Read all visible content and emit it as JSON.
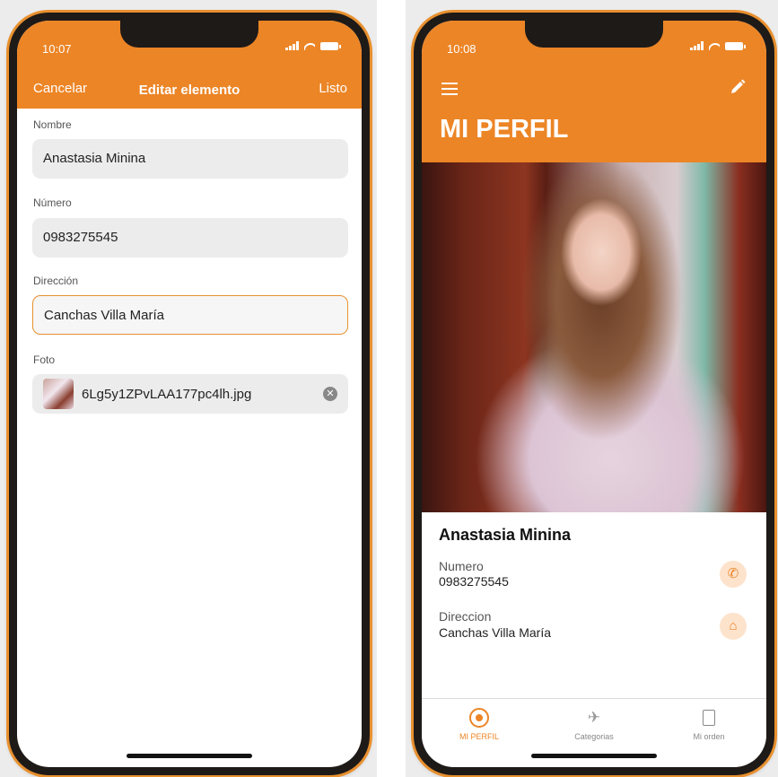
{
  "left_screen": {
    "status_time": "10:07",
    "nav": {
      "cancel_label": "Cancelar",
      "title": "Editar elemento",
      "done_label": "Listo"
    },
    "fields": {
      "nombre_label": "Nombre",
      "nombre_value": "Anastasia Minina",
      "numero_label": "Número",
      "numero_value": "0983275545",
      "direccion_label": "Dirección",
      "direccion_value": "Canchas Villa María",
      "foto_label": "Foto",
      "foto_filename": "6Lg5y1ZPvLAA177pc4lh.jpg"
    }
  },
  "right_screen": {
    "status_time": "10:08",
    "title": "MI PERFIL",
    "profile": {
      "name": "Anastasia Minina",
      "numero_label": "Numero",
      "numero_value": "0983275545",
      "direccion_label": "Direccion",
      "direccion_value": "Canchas Villa María"
    },
    "tabs": [
      {
        "label": "MI PERFIL",
        "icon": "broadcast-icon",
        "active": true
      },
      {
        "label": "Categorias",
        "icon": "satellite-icon",
        "active": false
      },
      {
        "label": "Mi orden",
        "icon": "receipt-icon",
        "active": false
      }
    ]
  },
  "colors": {
    "accent": "#ec8526",
    "accent_light": "#fde3cc",
    "field_bg": "#ececec",
    "frame": "#1e1a18"
  }
}
